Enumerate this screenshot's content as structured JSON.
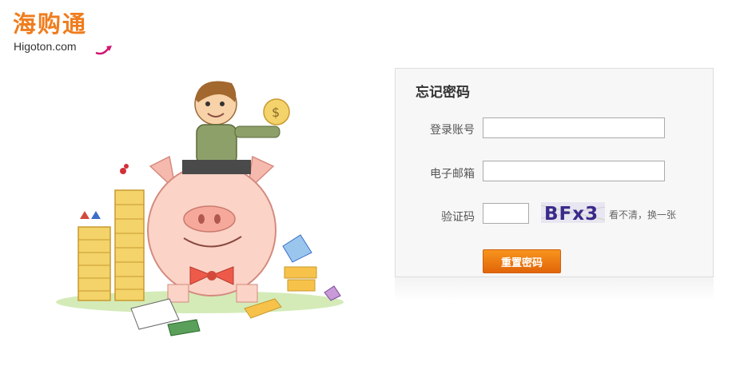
{
  "logo": {
    "cn": "海购通",
    "en": "Higoton.com"
  },
  "form": {
    "title": "忘记密码",
    "account_label": "登录账号",
    "account_value": "",
    "email_label": "电子邮箱",
    "email_value": "",
    "captcha_label": "验证码",
    "captcha_value": "",
    "captcha_text": "BFx3",
    "refresh_text": "看不清，换一张",
    "submit_label": "重置密码"
  },
  "colors": {
    "brand": "#ef7d1e",
    "button": "#f08519",
    "panel_bg": "#f7f7f7"
  }
}
